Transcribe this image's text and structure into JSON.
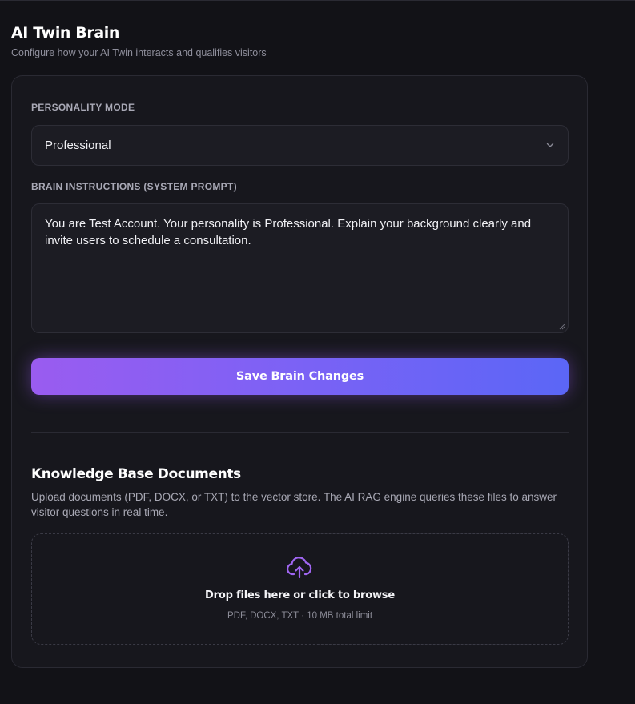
{
  "header": {
    "title": "AI Twin Brain",
    "subtitle": "Configure how your AI Twin interacts and qualifies visitors"
  },
  "personality": {
    "label": "PERSONALITY MODE",
    "selected": "Professional"
  },
  "instructions": {
    "label": "BRAIN INSTRUCTIONS (SYSTEM PROMPT)",
    "value": "You are Test Account. Your personality is Professional. Explain your background clearly and invite users to schedule a consultation."
  },
  "actions": {
    "save_label": "Save Brain Changes"
  },
  "knowledge_base": {
    "title": "Knowledge Base Documents",
    "description": "Upload documents (PDF, DOCX, or TXT) to the vector store. The AI RAG engine queries these files to answer visitor questions in real time.",
    "dropzone_title": "Drop files here or click to browse",
    "dropzone_hint": "PDF, DOCX, TXT · 10 MB total limit"
  },
  "icons": {
    "select_chevron": "chevron-down-icon",
    "upload": "cloud-upload-icon"
  },
  "colors": {
    "accent_start": "#9a5cf0",
    "accent_end": "#5b66f6",
    "upload_icon": "#a066f2",
    "background": "#121217",
    "card": "#17171d"
  }
}
